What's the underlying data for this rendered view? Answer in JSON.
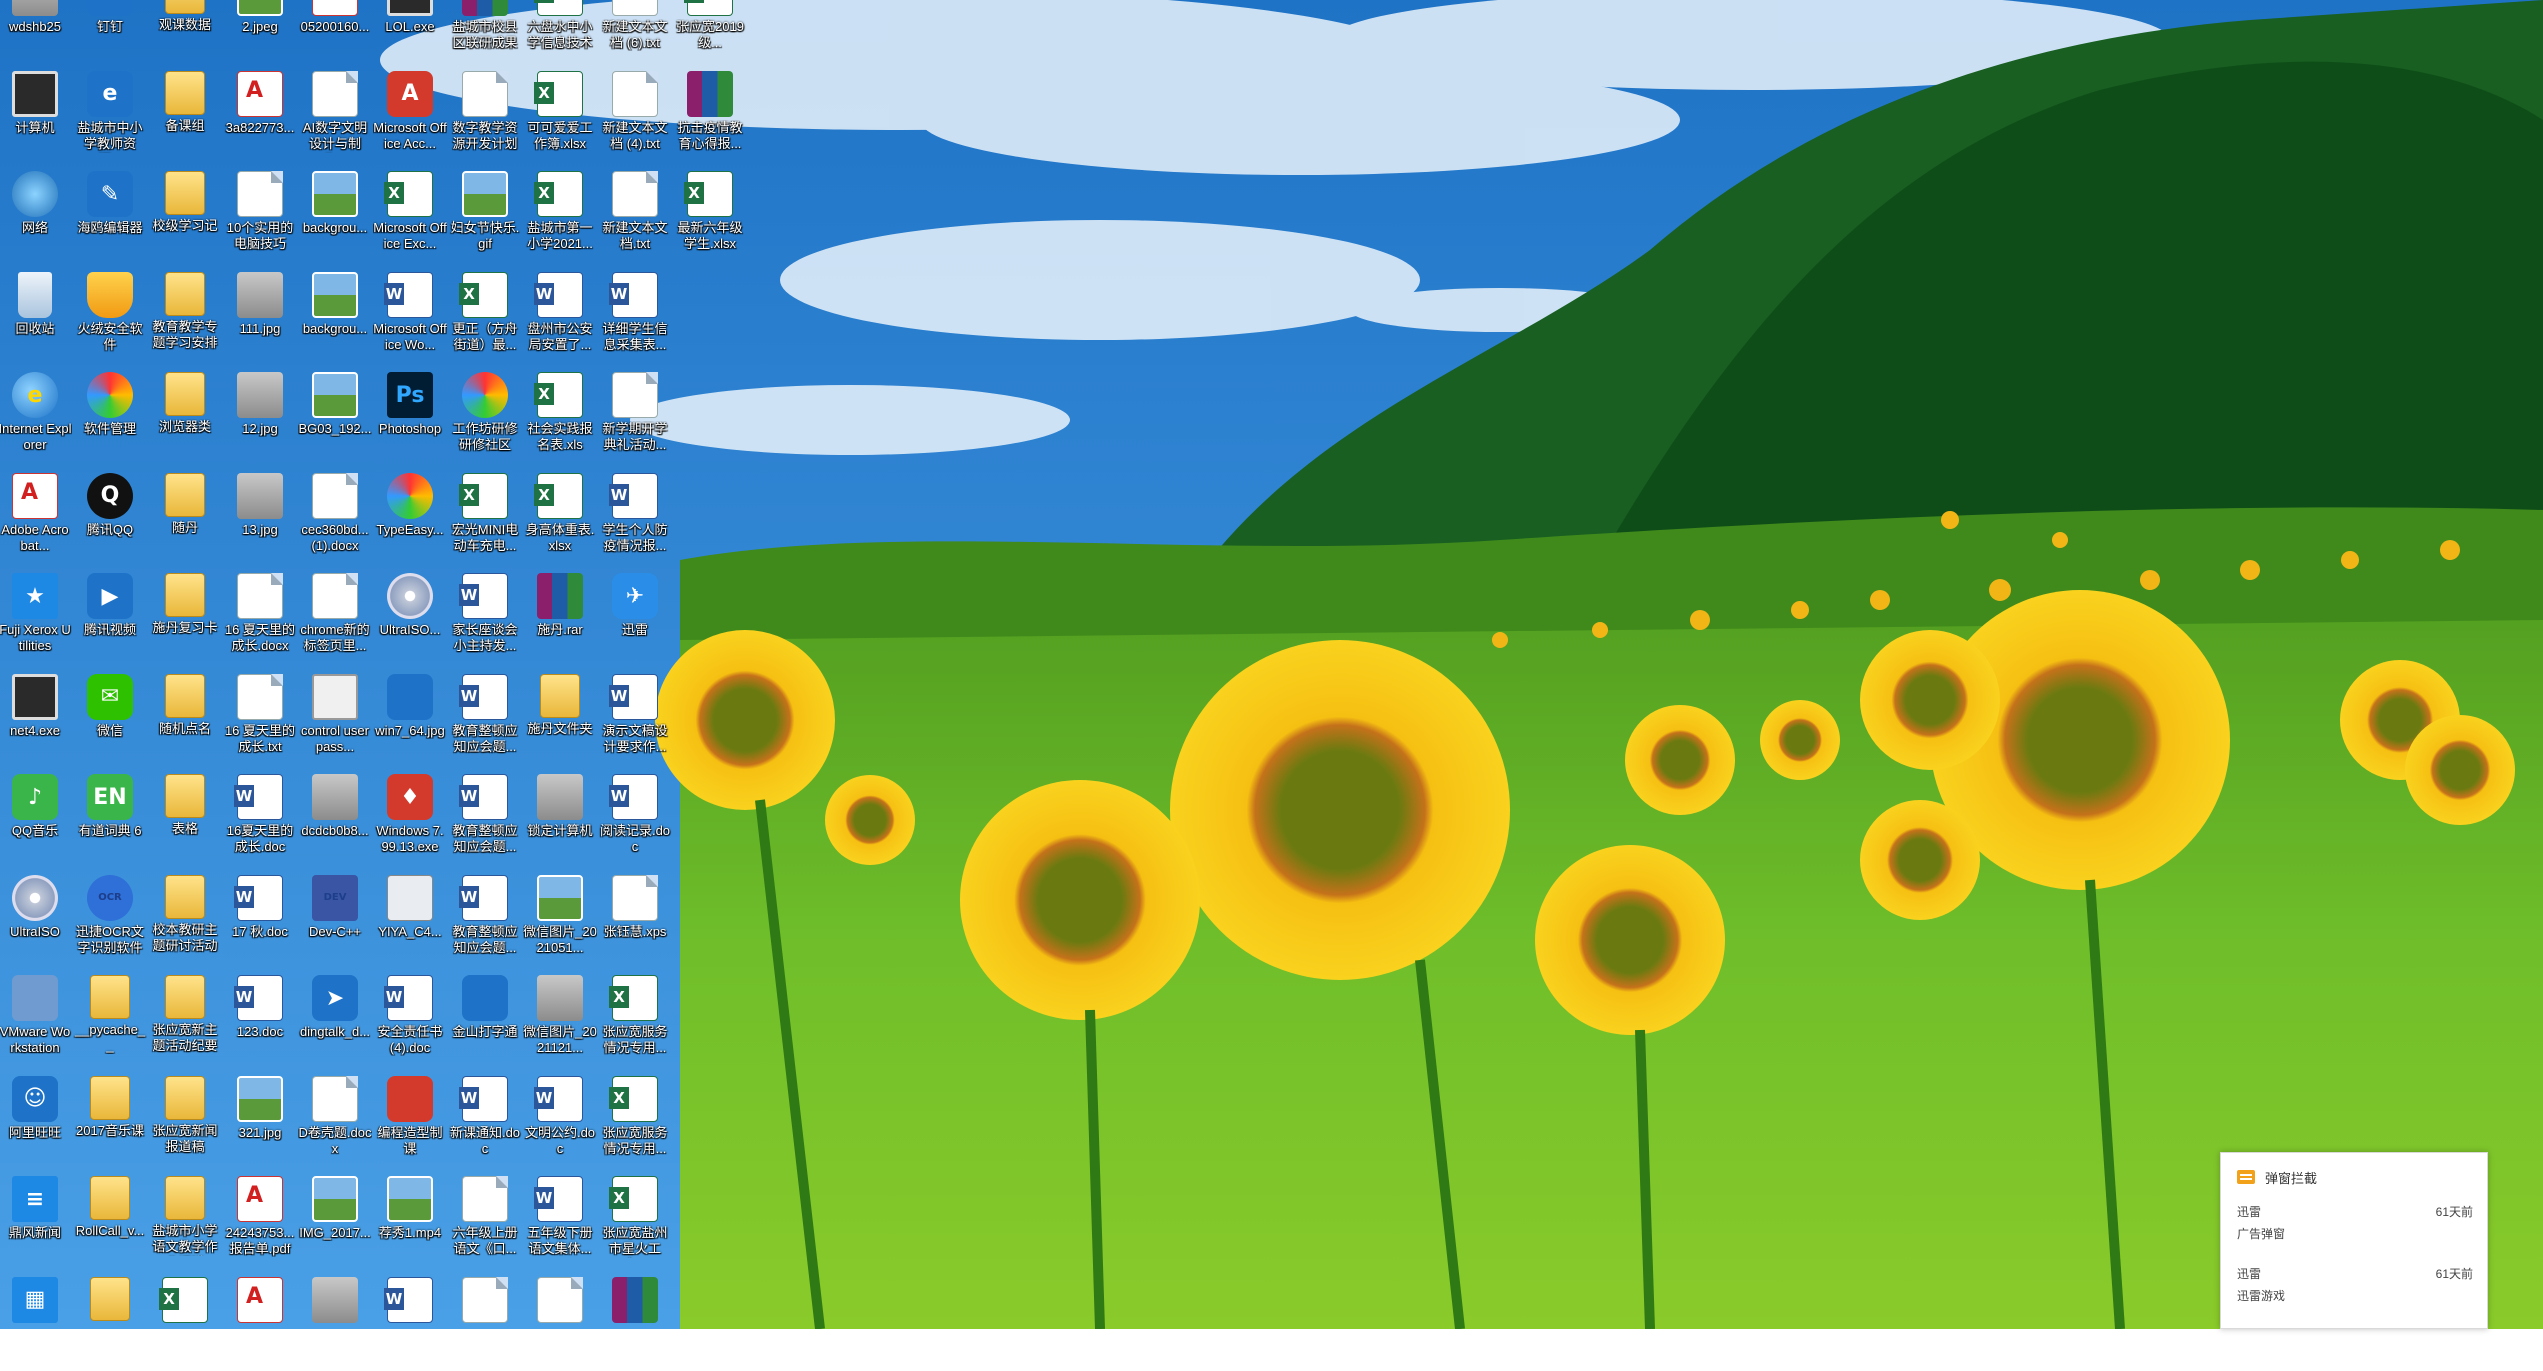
{
  "desktop": {
    "icons": [
      {
        "label": "wdshb25",
        "kind": "k-gray",
        "glyph": ""
      },
      {
        "label": "计算机",
        "kind": "k-monitor",
        "glyph": ""
      },
      {
        "label": "网络",
        "kind": "k-net",
        "glyph": ""
      },
      {
        "label": "回收站",
        "kind": "k-bin",
        "glyph": ""
      },
      {
        "label": "Internet Explorer",
        "kind": "k-ie",
        "glyph": "e"
      },
      {
        "label": "Adobe Acrobat...",
        "kind": "k-pdf",
        "glyph": ""
      },
      {
        "label": "Fuji Xerox Utilities",
        "kind": "k-tile",
        "glyph": "★"
      },
      {
        "label": "net4.exe",
        "kind": "k-monitor",
        "glyph": ""
      },
      {
        "label": "QQ音乐",
        "kind": "k-app-green",
        "glyph": "♪"
      },
      {
        "label": "UltraISO",
        "kind": "k-cd",
        "glyph": ""
      },
      {
        "label": "VMware Workstation",
        "kind": "k-vm",
        "glyph": ""
      },
      {
        "label": "阿里旺旺",
        "kind": "k-app-blue",
        "glyph": "☺"
      },
      {
        "label": "鼎风新闻",
        "kind": "k-tile",
        "glyph": "≡"
      },
      {
        "label": "",
        "kind": "k-tile",
        "glyph": "▦"
      },
      {
        "label": "钉钉",
        "kind": "k-app-blue",
        "glyph": ""
      },
      {
        "label": "盐城市中小学教师资源...",
        "kind": "k-app-blue",
        "glyph": "e"
      },
      {
        "label": "海鸥编辑器",
        "kind": "k-app-blue",
        "glyph": "✎"
      },
      {
        "label": "火绒安全软件",
        "kind": "k-shield",
        "glyph": ""
      },
      {
        "label": "软件管理",
        "kind": "k-typeeasy",
        "glyph": ""
      },
      {
        "label": "腾讯QQ",
        "kind": "k-qq",
        "glyph": "Q"
      },
      {
        "label": "腾讯视频",
        "kind": "k-app-blue",
        "glyph": "▶"
      },
      {
        "label": "微信",
        "kind": "k-wechat",
        "glyph": "✉"
      },
      {
        "label": "有道词典 6",
        "kind": "k-app-green",
        "glyph": "EN"
      },
      {
        "label": "迅捷OCR文字识别软件",
        "kind": "k-ocr",
        "glyph": "OCR"
      },
      {
        "label": "__pycache__",
        "kind": "k-folder",
        "glyph": ""
      },
      {
        "label": "2017音乐课",
        "kind": "k-folder",
        "glyph": ""
      },
      {
        "label": "RollCall_v...",
        "kind": "k-folder",
        "glyph": ""
      },
      {
        "label": "",
        "kind": "k-folder",
        "glyph": ""
      },
      {
        "label": "观课数据",
        "kind": "k-folder",
        "glyph": ""
      },
      {
        "label": "备课组",
        "kind": "k-folder",
        "glyph": ""
      },
      {
        "label": "校级学习记",
        "kind": "k-folder",
        "glyph": ""
      },
      {
        "label": "教育教学专题学习安排",
        "kind": "k-folder",
        "glyph": ""
      },
      {
        "label": "浏览器类",
        "kind": "k-folder",
        "glyph": ""
      },
      {
        "label": "随丹",
        "kind": "k-folder",
        "glyph": ""
      },
      {
        "label": "施丹复习卡",
        "kind": "k-folder",
        "glyph": ""
      },
      {
        "label": "随机点名",
        "kind": "k-folder",
        "glyph": ""
      },
      {
        "label": "表格",
        "kind": "k-folder",
        "glyph": ""
      },
      {
        "label": "校本教研主题研讨活动",
        "kind": "k-folder",
        "glyph": ""
      },
      {
        "label": "张应宽新主题活动纪要",
        "kind": "k-folder",
        "glyph": ""
      },
      {
        "label": "张应宽新闻报道稿",
        "kind": "k-folder",
        "glyph": ""
      },
      {
        "label": "盐城市小学语文教学作业评讲",
        "kind": "k-folder",
        "glyph": ""
      },
      {
        "label": "",
        "kind": "k-excel",
        "glyph": ""
      },
      {
        "label": "2.jpeg",
        "kind": "k-image",
        "glyph": ""
      },
      {
        "label": "3a822773...",
        "kind": "k-pdf",
        "glyph": ""
      },
      {
        "label": "10个实用的电脑技巧",
        "kind": "k-doc",
        "glyph": ""
      },
      {
        "label": "111.jpg",
        "kind": "k-gray",
        "glyph": ""
      },
      {
        "label": "12.jpg",
        "kind": "k-gray",
        "glyph": ""
      },
      {
        "label": "13.jpg",
        "kind": "k-gray",
        "glyph": ""
      },
      {
        "label": "16 夏天里的成长.docx",
        "kind": "k-doc",
        "glyph": ""
      },
      {
        "label": "16 夏天里的成长.txt",
        "kind": "k-doc",
        "glyph": ""
      },
      {
        "label": "16夏天里的成长.doc",
        "kind": "k-word",
        "glyph": ""
      },
      {
        "label": "17 秋.doc",
        "kind": "k-word",
        "glyph": ""
      },
      {
        "label": "123.doc",
        "kind": "k-word",
        "glyph": ""
      },
      {
        "label": "321.jpg",
        "kind": "k-image",
        "glyph": ""
      },
      {
        "label": "24243753...报告单.pdf",
        "kind": "k-pdf",
        "glyph": ""
      },
      {
        "label": "",
        "kind": "k-pdf",
        "glyph": ""
      },
      {
        "label": "05200160...",
        "kind": "k-pdf",
        "glyph": ""
      },
      {
        "label": "AI数字文明设计与制作...",
        "kind": "k-doc",
        "glyph": ""
      },
      {
        "label": "backgrou...",
        "kind": "k-image",
        "glyph": ""
      },
      {
        "label": "backgrou...",
        "kind": "k-image",
        "glyph": ""
      },
      {
        "label": "BG03_192...",
        "kind": "k-image",
        "glyph": ""
      },
      {
        "label": "cec360bd...(1).docx",
        "kind": "k-doc",
        "glyph": ""
      },
      {
        "label": "chrome新的标签页里...",
        "kind": "k-doc",
        "glyph": ""
      },
      {
        "label": "control userpass...",
        "kind": "k-card",
        "glyph": ""
      },
      {
        "label": "dcdcb0b8...",
        "kind": "k-gray",
        "glyph": ""
      },
      {
        "label": "Dev-C++",
        "kind": "k-dev",
        "glyph": "DEV"
      },
      {
        "label": "dingtalk_d...",
        "kind": "k-app-blue",
        "glyph": "➤"
      },
      {
        "label": "D卷壳题.docx",
        "kind": "k-doc",
        "glyph": ""
      },
      {
        "label": "IMG_2017...",
        "kind": "k-image",
        "glyph": ""
      },
      {
        "label": "",
        "kind": "k-gray",
        "glyph": ""
      },
      {
        "label": "LOL.exe",
        "kind": "k-monitor",
        "glyph": ""
      },
      {
        "label": "Microsoft Office Acc...",
        "kind": "k-app-red",
        "glyph": "A"
      },
      {
        "label": "Microsoft Office Exc...",
        "kind": "k-excel",
        "glyph": ""
      },
      {
        "label": "Microsoft Office Wo...",
        "kind": "k-word",
        "glyph": ""
      },
      {
        "label": "Photoshop",
        "kind": "k-ps",
        "glyph": "Ps"
      },
      {
        "label": "TypeEasy...",
        "kind": "k-typeeasy",
        "glyph": ""
      },
      {
        "label": "UltraISO...",
        "kind": "k-cd",
        "glyph": ""
      },
      {
        "label": "win7_64.jpg",
        "kind": "k-app-blue",
        "glyph": ""
      },
      {
        "label": "Windows 7.99.13.exe",
        "kind": "k-app-red",
        "glyph": "♦"
      },
      {
        "label": "YIYA_C4...",
        "kind": "k-win",
        "glyph": ""
      },
      {
        "label": "安全责任书(4).doc",
        "kind": "k-word",
        "glyph": ""
      },
      {
        "label": "编程造型制课",
        "kind": "k-app-red",
        "glyph": ""
      },
      {
        "label": "荐秀1.mp4",
        "kind": "k-image",
        "glyph": ""
      },
      {
        "label": "",
        "kind": "k-word",
        "glyph": ""
      },
      {
        "label": "盐城市校县区联研成果",
        "kind": "k-rar",
        "glyph": ""
      },
      {
        "label": "数字教学资源开发计划",
        "kind": "k-doc",
        "glyph": ""
      },
      {
        "label": "妇女节快乐.gif",
        "kind": "k-image",
        "glyph": ""
      },
      {
        "label": "更正（方舟街道）最...",
        "kind": "k-excel",
        "glyph": ""
      },
      {
        "label": "工作坊研修研修社区",
        "kind": "k-typeeasy",
        "glyph": ""
      },
      {
        "label": "宏光MINI电动车充电...",
        "kind": "k-excel",
        "glyph": ""
      },
      {
        "label": "家长座谈会小主持发...",
        "kind": "k-word",
        "glyph": ""
      },
      {
        "label": "教育整顿应知应会题...",
        "kind": "k-word",
        "glyph": ""
      },
      {
        "label": "教育整顿应知应会题...",
        "kind": "k-word",
        "glyph": ""
      },
      {
        "label": "教育整顿应知应会题...",
        "kind": "k-word",
        "glyph": ""
      },
      {
        "label": "金山打字通",
        "kind": "k-app-blue",
        "glyph": ""
      },
      {
        "label": "新课通知.doc",
        "kind": "k-word",
        "glyph": ""
      },
      {
        "label": "六年级上册语文《口...",
        "kind": "k-doc",
        "glyph": ""
      },
      {
        "label": "",
        "kind": "k-doc",
        "glyph": ""
      },
      {
        "label": "六盘水中小学信息技术",
        "kind": "k-excel",
        "glyph": ""
      },
      {
        "label": "可可爱爱工作簿.xlsx",
        "kind": "k-excel",
        "glyph": ""
      },
      {
        "label": "盐城市第一小学2021...",
        "kind": "k-excel",
        "glyph": ""
      },
      {
        "label": "盘州市公安局安置了...",
        "kind": "k-word",
        "glyph": ""
      },
      {
        "label": "社会实践报名表.xls",
        "kind": "k-excel",
        "glyph": ""
      },
      {
        "label": "身高体重表.xlsx",
        "kind": "k-excel",
        "glyph": ""
      },
      {
        "label": "施丹.rar",
        "kind": "k-rar",
        "glyph": ""
      },
      {
        "label": "施丹文件夹",
        "kind": "k-folder",
        "glyph": ""
      },
      {
        "label": "锁定计算机",
        "kind": "k-gray",
        "glyph": ""
      },
      {
        "label": "微信图片_2021051...",
        "kind": "k-image",
        "glyph": ""
      },
      {
        "label": "微信图片_2021121...",
        "kind": "k-gray",
        "glyph": ""
      },
      {
        "label": "文明公约.doc",
        "kind": "k-word",
        "glyph": ""
      },
      {
        "label": "五年级下册语文集体...",
        "kind": "k-word",
        "glyph": ""
      },
      {
        "label": "",
        "kind": "k-doc",
        "glyph": ""
      },
      {
        "label": "新建文本文档 (6).txt",
        "kind": "k-doc",
        "glyph": ""
      },
      {
        "label": "新建文本文档 (4).txt",
        "kind": "k-doc",
        "glyph": ""
      },
      {
        "label": "新建文本文档.txt",
        "kind": "k-doc",
        "glyph": ""
      },
      {
        "label": "详细学生信息采集表...",
        "kind": "k-word",
        "glyph": ""
      },
      {
        "label": "新学期开学典礼活动...",
        "kind": "k-doc",
        "glyph": ""
      },
      {
        "label": "学生个人防疫情况报...",
        "kind": "k-word",
        "glyph": ""
      },
      {
        "label": "迅雷",
        "kind": "k-xunlei",
        "glyph": "✈"
      },
      {
        "label": "演示文稿设计要求作...",
        "kind": "k-word",
        "glyph": ""
      },
      {
        "label": "阅读记录.doc",
        "kind": "k-word",
        "glyph": ""
      },
      {
        "label": "张钰慧.xps",
        "kind": "k-doc",
        "glyph": ""
      },
      {
        "label": "张应宽服务情况专用...",
        "kind": "k-excel",
        "glyph": ""
      },
      {
        "label": "张应宽服务情况专用...",
        "kind": "k-excel",
        "glyph": ""
      },
      {
        "label": "张应宽盐州市星火工会...",
        "kind": "k-excel",
        "glyph": ""
      },
      {
        "label": "",
        "kind": "k-rar",
        "glyph": ""
      },
      {
        "label": "张应宽2019级...",
        "kind": "k-excel",
        "glyph": ""
      },
      {
        "label": "抗击疫情教育心得报...",
        "kind": "k-rar",
        "glyph": ""
      },
      {
        "label": "最新六年级学生.xlsx",
        "kind": "k-excel",
        "glyph": ""
      }
    ]
  },
  "toast": {
    "title": "弹窗拦截",
    "messages": [
      {
        "source": "迅雷",
        "time": "61天前",
        "text": "广告弹窗"
      },
      {
        "source": "迅雷",
        "time": "61天前",
        "text": "迅雷游戏"
      }
    ]
  }
}
